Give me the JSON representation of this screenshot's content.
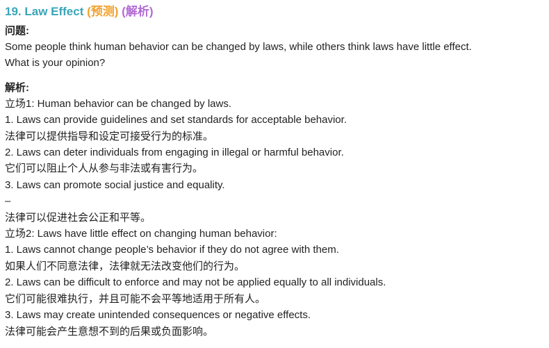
{
  "title": {
    "number_label": "19. Law Effect",
    "tag_predict": "(预测)",
    "tag_analysis": "(解析)"
  },
  "question": {
    "label": "问题:",
    "lines": [
      "Some people think human behavior can be changed by laws, while others think laws have little effect.",
      "What is your opinion?"
    ]
  },
  "analysis": {
    "label": "解析:",
    "lines": [
      "立场1: Human behavior can be changed by laws.",
      "1. Laws can provide guidelines and set standards for acceptable behavior.",
      "法律可以提供指导和设定可接受行为的标准。",
      "2. Laws can deter individuals from engaging in illegal or harmful behavior.",
      "它们可以阻止个人从参与非法或有害行为。",
      "3. Laws can promote social justice and equality.",
      "–",
      "法律可以促进社会公正和平等。",
      "立场2: Laws have little effect on changing human behavior:",
      "1. Laws cannot change people’s behavior if they do not agree with them.",
      "如果人们不同意法律，法律就无法改变他们的行为。",
      "2. Laws can be difficult to enforce and may not be applied equally to all individuals.",
      "它们可能很难执行，并且可能不会平等地适用于所有人。",
      "3. Laws may create unintended consequences or negative effects.",
      "法律可能会产生意想不到的后果或负面影响。"
    ]
  },
  "colors": {
    "title_number": "#3aa5b8",
    "tag_predict": "#f0a22e",
    "tag_analysis": "#b36ad6",
    "body_text": "#222222"
  }
}
